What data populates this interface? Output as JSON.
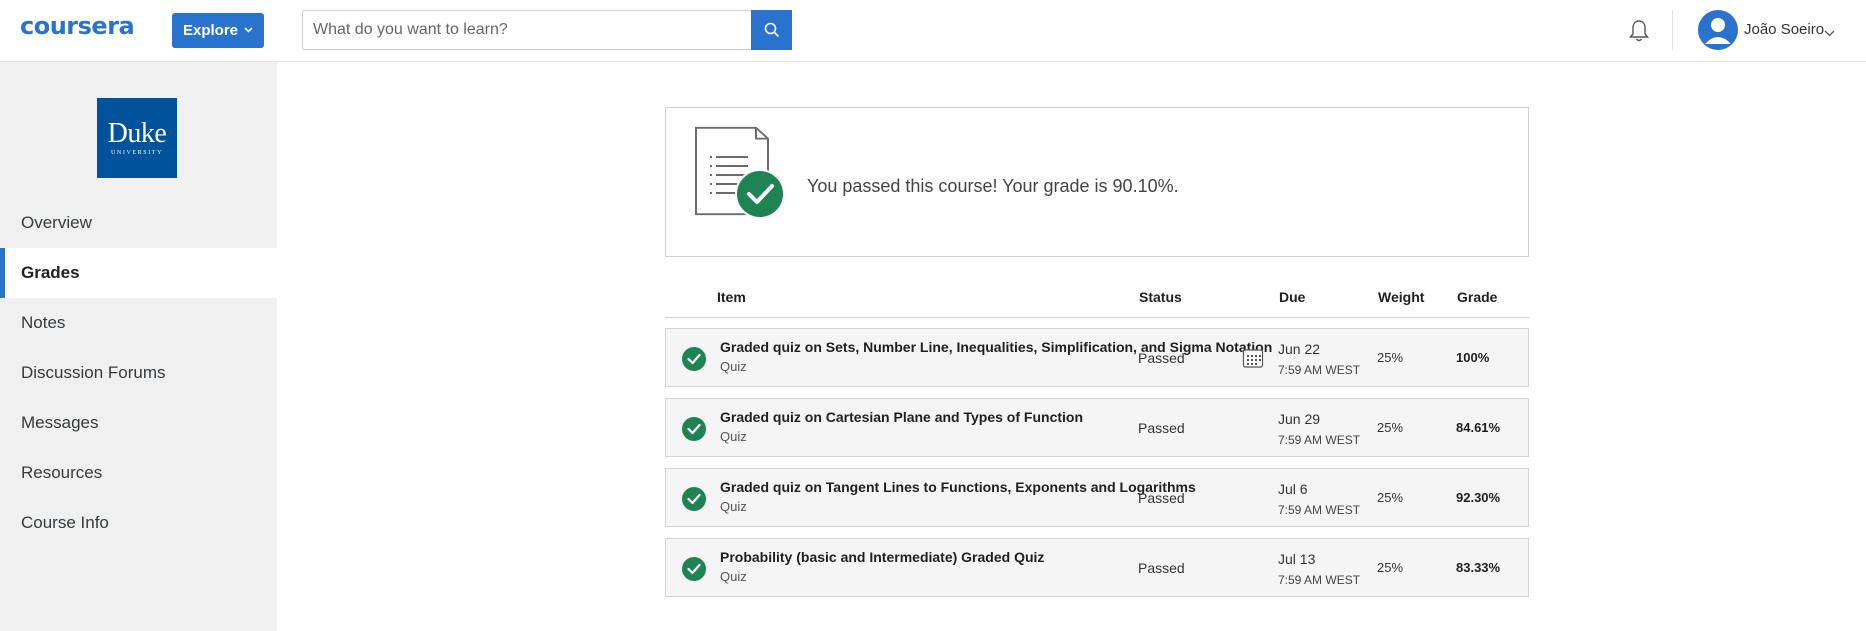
{
  "header": {
    "logo": "coursera",
    "explore_label": "Explore",
    "search_placeholder": "What do you want to learn?",
    "username": "João Soeiro"
  },
  "sidebar": {
    "university_name": "Duke",
    "university_sub": "UNIVERSITY",
    "items": [
      {
        "label": "Overview",
        "active": false
      },
      {
        "label": "Grades",
        "active": true
      },
      {
        "label": "Notes",
        "active": false
      },
      {
        "label": "Discussion Forums",
        "active": false
      },
      {
        "label": "Messages",
        "active": false
      },
      {
        "label": "Resources",
        "active": false
      },
      {
        "label": "Course Info",
        "active": false
      }
    ]
  },
  "summary": {
    "message": "You passed this course! Your grade is 90.10%."
  },
  "table": {
    "headers": {
      "item": "Item",
      "status": "Status",
      "due": "Due",
      "weight": "Weight",
      "grade": "Grade"
    },
    "rows": [
      {
        "title": "Graded quiz on Sets, Number Line, Inequalities, Simplification, and Sigma Notation",
        "type": "Quiz",
        "status": "Passed",
        "due_date": "Jun 22",
        "due_time": "7:59 AM WEST",
        "weight": "25%",
        "grade": "100%"
      },
      {
        "title": "Graded quiz on Cartesian Plane and Types of Function",
        "type": "Quiz",
        "status": "Passed",
        "due_date": "Jun 29",
        "due_time": "7:59 AM WEST",
        "weight": "25%",
        "grade": "84.61%"
      },
      {
        "title": "Graded quiz on Tangent Lines to Functions, Exponents and Logarithms",
        "type": "Quiz",
        "status": "Passed",
        "due_date": "Jul 6",
        "due_time": "7:59 AM WEST",
        "weight": "25%",
        "grade": "92.30%"
      },
      {
        "title": "Probability (basic and Intermediate) Graded Quiz",
        "type": "Quiz",
        "status": "Passed",
        "due_date": "Jul 13",
        "due_time": "7:59 AM WEST",
        "weight": "25%",
        "grade": "83.33%"
      }
    ]
  },
  "colors": {
    "brand": "#2a73cc",
    "passed_green": "#1f8354",
    "duke_blue": "#00539b"
  }
}
